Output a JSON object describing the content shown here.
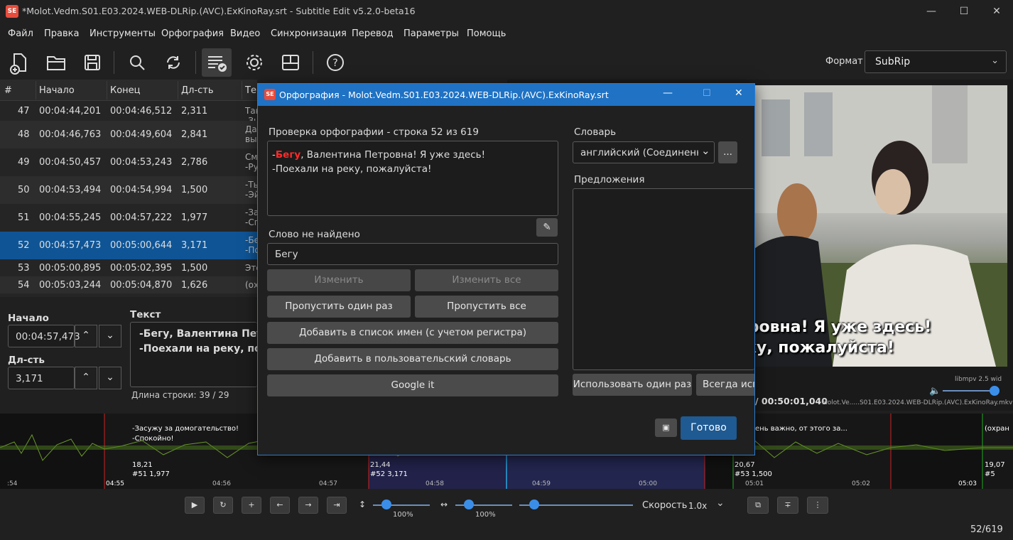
{
  "app": {
    "title": "*Molot.Vedm.S01.E03.2024.WEB-DLRip.(AVC).ExKinoRay.srt - Subtitle Edit v5.2.0-beta16",
    "logo": "SE"
  },
  "menu": [
    "Файл",
    "Правка",
    "Инструменты",
    "Орфография",
    "Видео",
    "Синхронизация",
    "Перевод",
    "Параметры",
    "Помощь"
  ],
  "format": {
    "label": "Формат",
    "value": "SubRip"
  },
  "grid": {
    "headers": [
      "#",
      "Начало",
      "Конец",
      "Дл-сть",
      "Те"
    ],
    "rows": [
      {
        "n": "47",
        "start": "00:04:44,201",
        "end": "00:04:46,512",
        "dur": "2,311",
        "text": "Так\n-Зн"
      },
      {
        "n": "48",
        "start": "00:04:46,763",
        "end": "00:04:49,604",
        "dur": "2,841",
        "text": "Да\nвы"
      },
      {
        "n": "49",
        "start": "00:04:50,457",
        "end": "00:04:53,243",
        "dur": "2,786",
        "text": "См\n-Ру"
      },
      {
        "n": "50",
        "start": "00:04:53,494",
        "end": "00:04:54,994",
        "dur": "1,500",
        "text": "-Ть\n-Эй"
      },
      {
        "n": "51",
        "start": "00:04:55,245",
        "end": "00:04:57,222",
        "dur": "1,977",
        "text": "-За\n-Сп"
      },
      {
        "n": "52",
        "start": "00:04:57,473",
        "end": "00:05:00,644",
        "dur": "3,171",
        "text": "-Бе\n-По"
      },
      {
        "n": "53",
        "start": "00:05:00,895",
        "end": "00:05:02,395",
        "dur": "1,500",
        "text": "Это"
      },
      {
        "n": "54",
        "start": "00:05:03,244",
        "end": "00:05:04,870",
        "dur": "1,626",
        "text": "(ох"
      }
    ]
  },
  "edit": {
    "start_label": "Начало",
    "start_value": "00:04:57,473",
    "dur_label": "Дл-сть",
    "dur_value": "3,171",
    "text_label": "Текст",
    "text_line1": "-Бегу, Валентина Петро",
    "text_line2": "-Поехали на реку, пож",
    "line_length": "Длина строки:  39 / 29"
  },
  "video": {
    "sub1": "тровна! Я уже здесь!",
    "sub2": "ку, пожалуйста!",
    "player": "libmpv 2.5 wid",
    "time": "/ 00:50:01,040",
    "file": "Molot.Ve.....S01.E03.2024.WEB-DLRip.(AVC).ExKinoRay.mkv"
  },
  "dialog": {
    "title": "Орфография - Molot.Vedm.S01.E03.2024.WEB-DLRip.(AVC).ExKinoRay.srt",
    "check_label": "Проверка орфографии - строка 52 из 619",
    "line1_prefix": "-",
    "line1_word": "Бегу",
    "line1_rest": ", Валентина Петровна! Я уже здесь!",
    "line2": "-Поехали на реку, пожалуйста!",
    "not_found_label": "Слово не найдено",
    "word": "Бегу",
    "change": "Изменить",
    "change_all": "Изменить все",
    "skip_once": "Пропустить один раз",
    "skip_all": "Пропустить все",
    "add_names": "Добавить в список имен (с учетом регистра)",
    "add_user_dict": "Добавить в пользовательский словарь",
    "google": "Google it",
    "dict_label": "Словарь",
    "dict_value": "английский (Соединенн",
    "dict_more": "...",
    "suggestions_label": "Предложения",
    "use_once": "Использовать один раз",
    "always_use": "Всегда испо",
    "done": "Готово"
  },
  "wave": {
    "left_sub1": "-Засужу за домогательство!",
    "left_sub2": "-Спокойно!",
    "left_info1": "18,21",
    "left_info2": "#51  1,977",
    "mid_info1": "21,44",
    "mid_info2": "#52  3,171",
    "right_sub": "ень важно, от этого за...",
    "right_info1": "20,67",
    "right_info2": "#53  1,500",
    "far_sub": "(охран",
    "far_info1": "19,07",
    "far_info2": "#5",
    "ticks": [
      ":54",
      "04:55",
      "04:56",
      "04:57",
      "04:58",
      "04:59",
      "05:00",
      "05:01",
      "05:02",
      "05:03"
    ]
  },
  "controls": {
    "vzoom": "100%",
    "hzoom": "100%",
    "speed_label": "Скорость",
    "speed_value": "1.0x",
    "counter": "52/619"
  }
}
